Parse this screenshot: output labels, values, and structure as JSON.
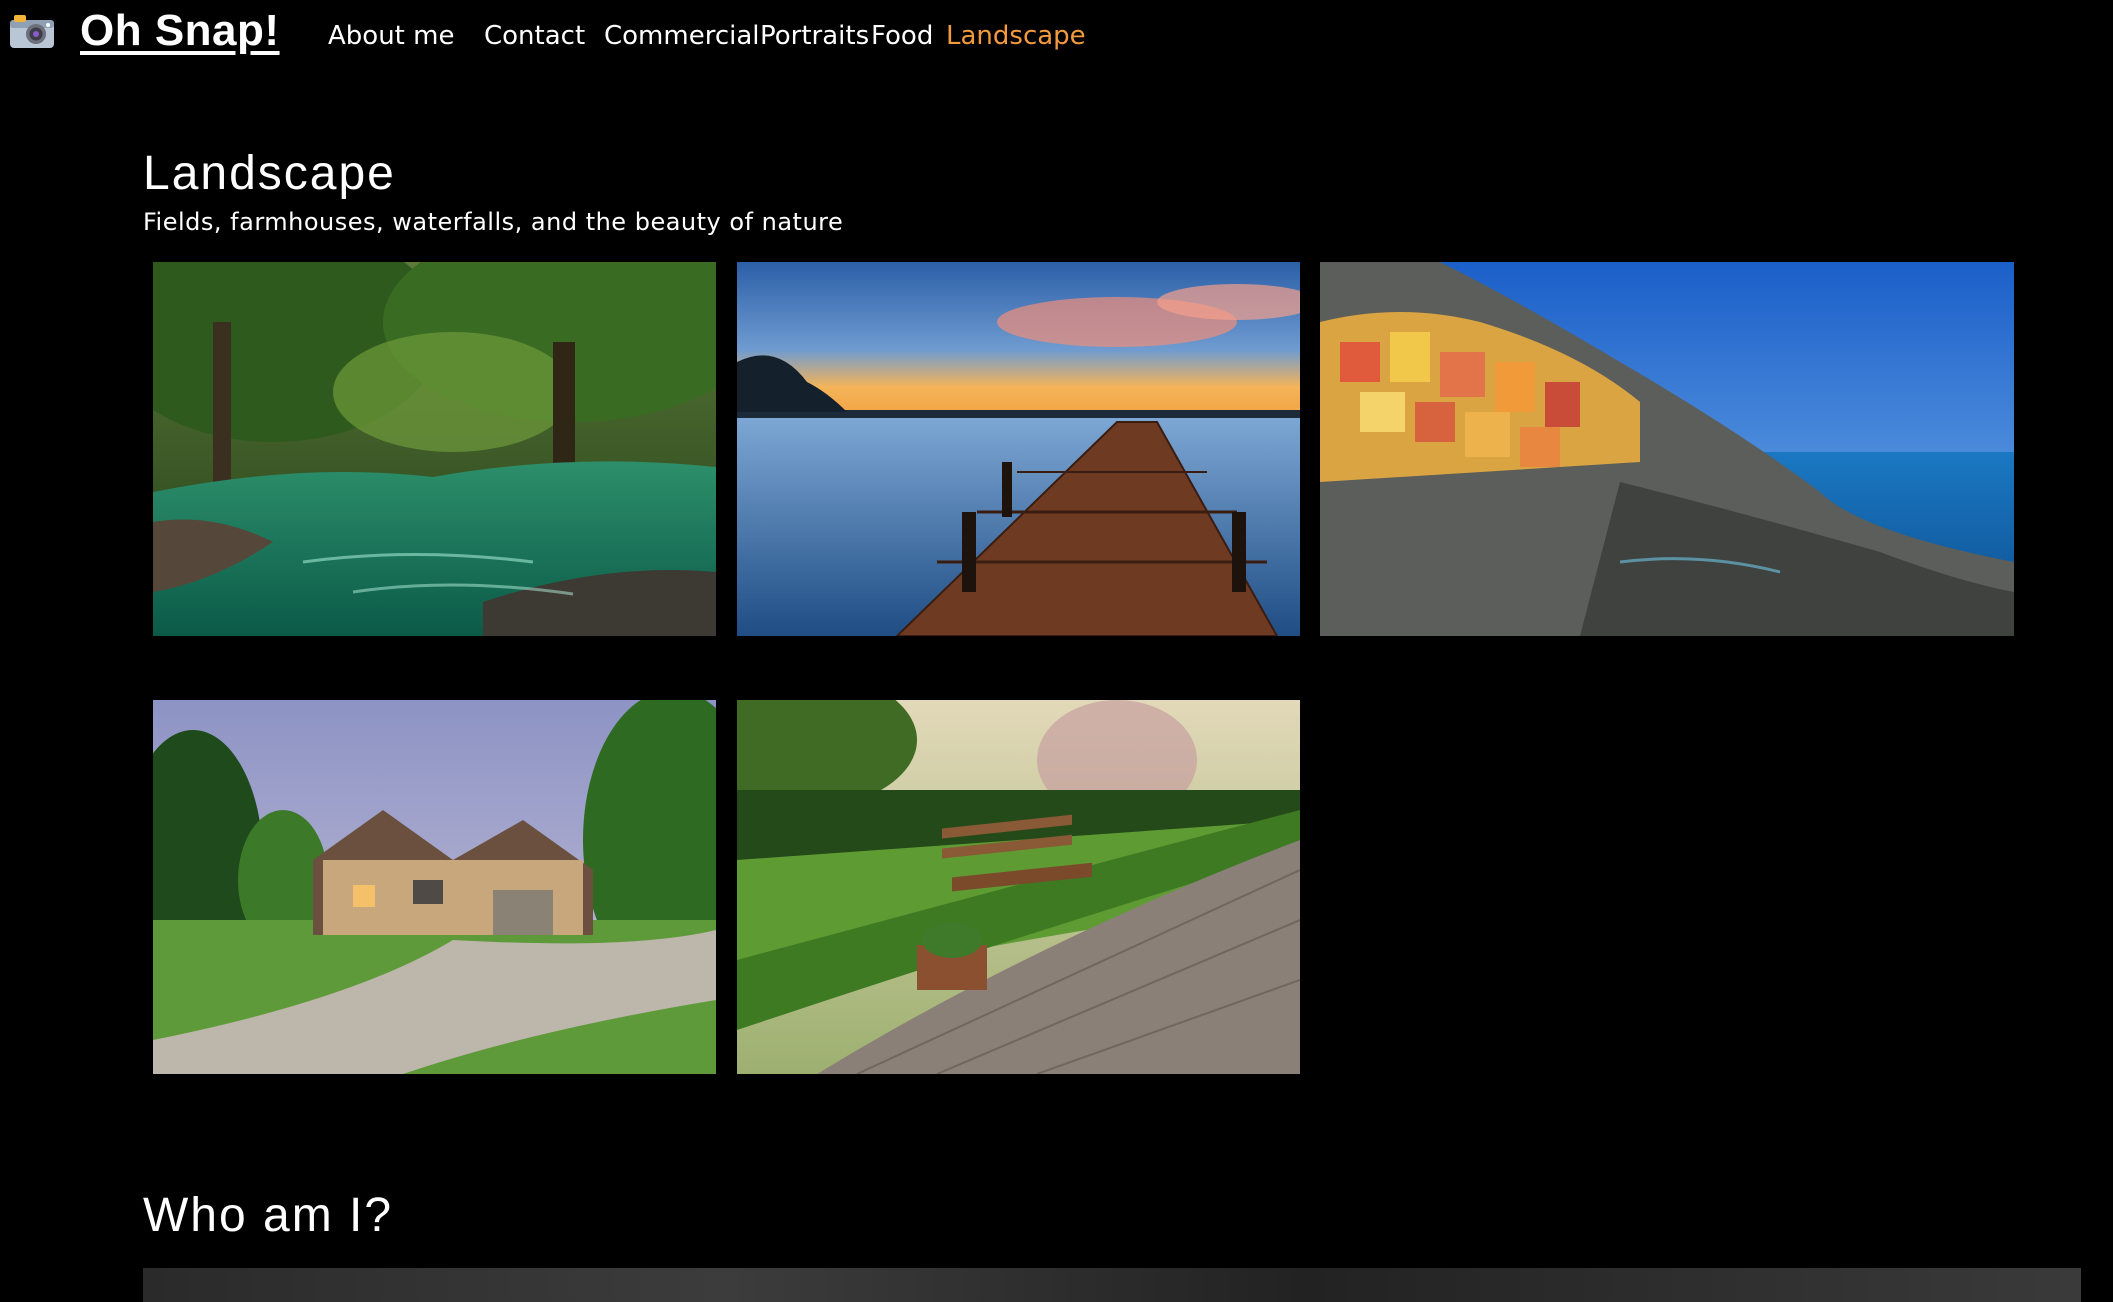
{
  "nav": {
    "brand": "Oh Snap!",
    "links": [
      {
        "label": "About me"
      },
      {
        "label": "Contact"
      },
      {
        "label": "Commercial"
      },
      {
        "label": "Portraits"
      },
      {
        "label": "Food"
      },
      {
        "label": "Landscape"
      }
    ],
    "active_color": "#f39a3c"
  },
  "section": {
    "title": "Landscape",
    "subtitle": "Fields, farmhouses, waterfalls, and the beauty of nature"
  },
  "gallery": [
    {
      "subject": "forest river"
    },
    {
      "subject": "wooden pier at sunset"
    },
    {
      "subject": "cliffside coastal village"
    },
    {
      "subject": "stone farmhouse with driveway"
    },
    {
      "subject": "park bench by hedge"
    }
  ],
  "about": {
    "title": "Who am I?"
  },
  "colors": {
    "background": "#000000",
    "text": "#ffffff",
    "accent": "#f39a3c"
  }
}
